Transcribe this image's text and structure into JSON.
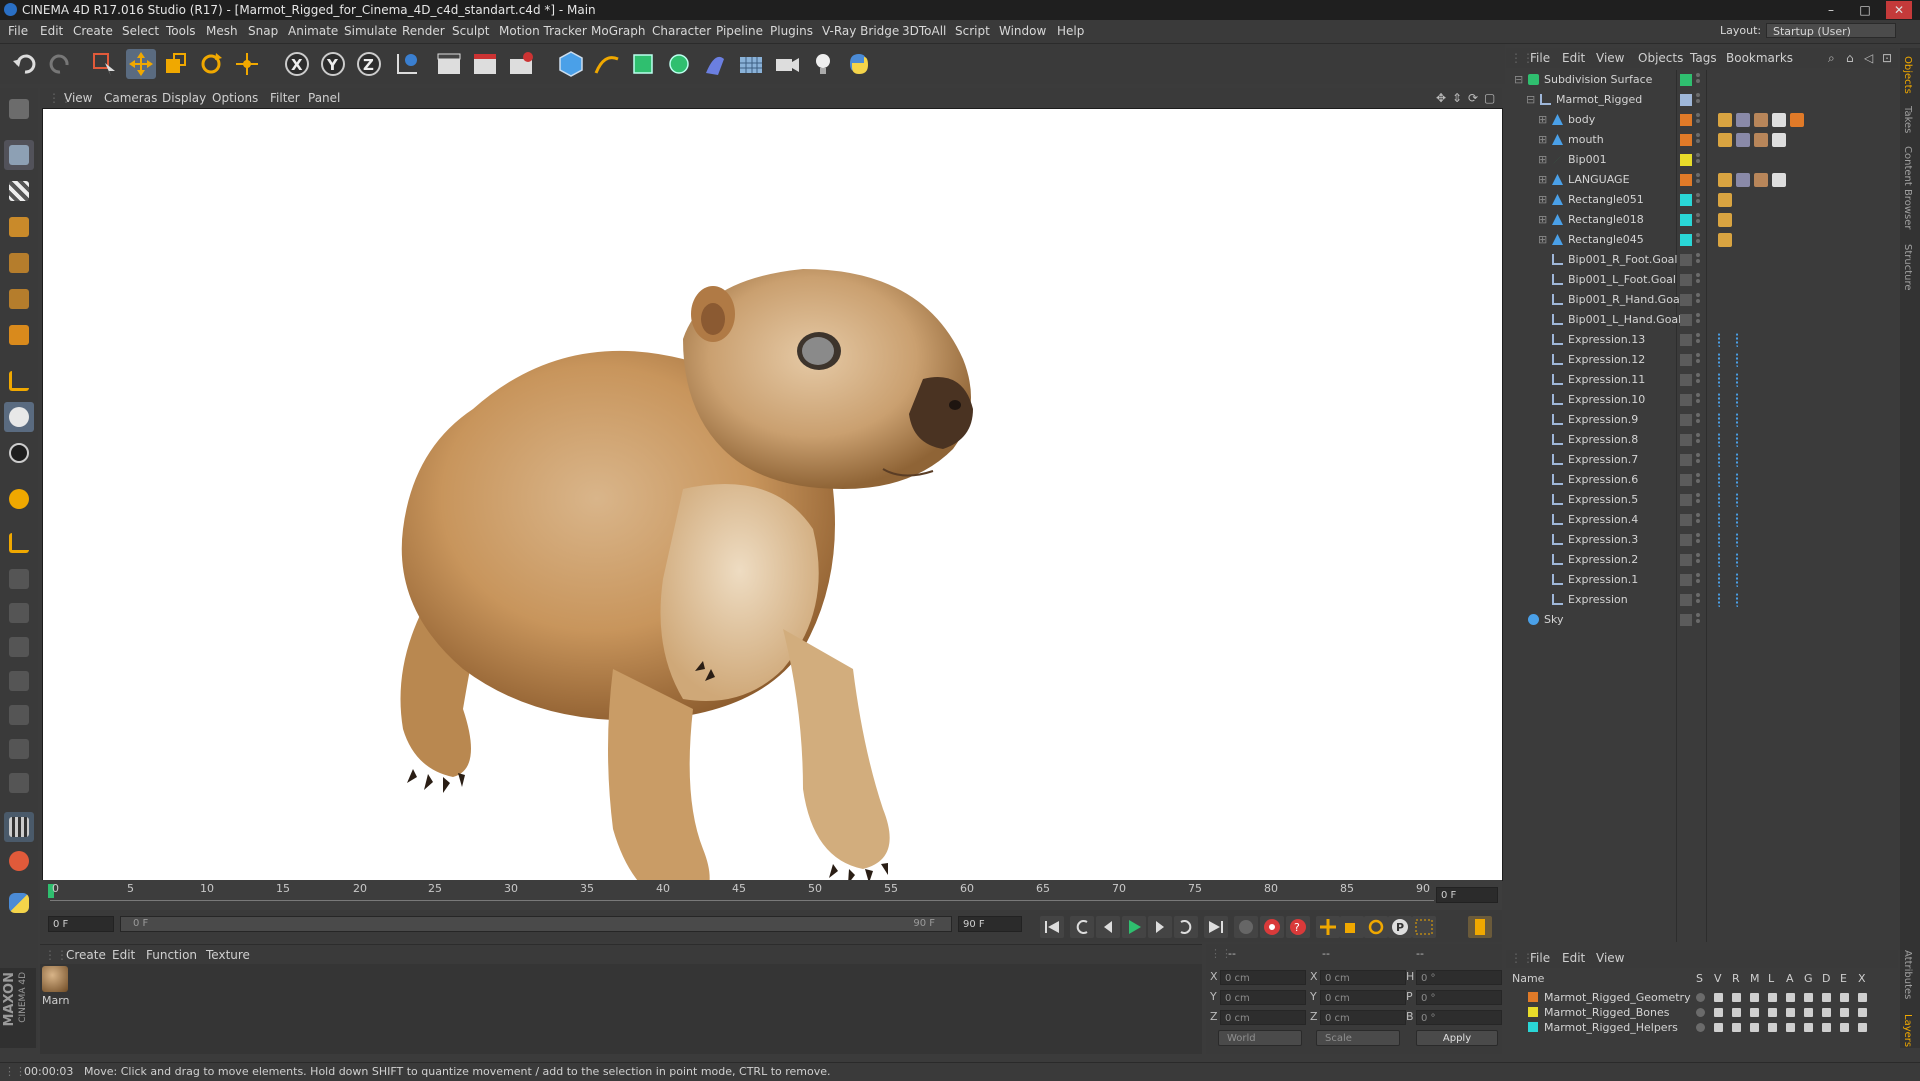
{
  "window": {
    "title": "CINEMA 4D R17.016 Studio (R17) - [Marmot_Rigged_for_Cinema_4D_c4d_standart.c4d *] - Main",
    "controls": [
      "–",
      "□",
      "✕"
    ]
  },
  "menu": [
    "File",
    "Edit",
    "Create",
    "Select",
    "Tools",
    "Mesh",
    "Snap",
    "Animate",
    "Simulate",
    "Render",
    "Sculpt",
    "Motion Tracker",
    "MoGraph",
    "Character",
    "Pipeline",
    "Plugins",
    "V-Ray Bridge",
    "3DToAll",
    "Script",
    "Window",
    "Help"
  ],
  "layout": {
    "label": "Layout:",
    "value": "Startup (User)"
  },
  "viewport_menu": [
    "View",
    "Cameras",
    "Display",
    "Options",
    "Filter",
    "Panel"
  ],
  "timeline": {
    "ticks": [
      "0",
      "5",
      "10",
      "15",
      "20",
      "25",
      "30",
      "35",
      "40",
      "45",
      "50",
      "55",
      "60",
      "65",
      "70",
      "75",
      "80",
      "85",
      "90"
    ],
    "current_frame_field": "0 F",
    "start_field": "0 F",
    "range_start": "0 F",
    "range_end": "90 F",
    "end_field": "90 F"
  },
  "material_menu": [
    "Create",
    "Edit",
    "Function",
    "Texture"
  ],
  "material": {
    "name": "Marn"
  },
  "brand": {
    "maxon": "MAXON",
    "c4d": "CINEMA 4D"
  },
  "coords": {
    "headers": [
      "--",
      "--",
      "--"
    ],
    "rows": [
      {
        "l1": "X",
        "v1": "0 cm",
        "l2": "X",
        "v2": "0 cm",
        "l3": "H",
        "v3": "0 °"
      },
      {
        "l1": "Y",
        "v1": "0 cm",
        "l2": "Y",
        "v2": "0 cm",
        "l3": "P",
        "v3": "0 °"
      },
      {
        "l1": "Z",
        "v1": "0 cm",
        "l2": "Z",
        "v2": "0 cm",
        "l3": "B",
        "v3": "0 °"
      }
    ],
    "world": "World",
    "scale": "Scale",
    "apply": "Apply"
  },
  "object_manager": {
    "menu": [
      "File",
      "Edit",
      "View",
      "Objects",
      "Tags",
      "Bookmarks"
    ],
    "objects": [
      {
        "name": "Subdivision Surface",
        "indent": 0,
        "icon": "subdivision-icon",
        "color": "#2fbf6f",
        "tags": 0
      },
      {
        "name": "Marmot_Rigged",
        "indent": 1,
        "icon": "null-icon",
        "color": "#9fb7d9",
        "tags": 0
      },
      {
        "name": "body",
        "indent": 2,
        "icon": "polygon-icon",
        "color": "#e07a28",
        "tags": 5
      },
      {
        "name": "mouth",
        "indent": 2,
        "icon": "polygon-icon",
        "color": "#e07a28",
        "tags": 4
      },
      {
        "name": "Bip001",
        "indent": 2,
        "icon": "bone-icon",
        "color": "#e8dc2a",
        "tags": 0
      },
      {
        "name": "LANGUAGE",
        "indent": 2,
        "icon": "polygon-icon",
        "color": "#e07a28",
        "tags": 4
      },
      {
        "name": "Rectangle051",
        "indent": 2,
        "icon": "polygon-icon",
        "color": "#2ad6d6",
        "tags": 1
      },
      {
        "name": "Rectangle018",
        "indent": 2,
        "icon": "polygon-icon",
        "color": "#2ad6d6",
        "tags": 1
      },
      {
        "name": "Rectangle045",
        "indent": 2,
        "icon": "polygon-icon",
        "color": "#2ad6d6",
        "tags": 1
      },
      {
        "name": "Bip001_R_Foot.Goal",
        "indent": 2,
        "icon": "null-icon",
        "color": "",
        "tags": 0
      },
      {
        "name": "Bip001_L_Foot.Goal",
        "indent": 2,
        "icon": "null-icon",
        "color": "",
        "tags": 0
      },
      {
        "name": "Bip001_R_Hand.Goal",
        "indent": 2,
        "icon": "null-icon",
        "color": "",
        "tags": 0
      },
      {
        "name": "Bip001_L_Hand.Goal",
        "indent": 2,
        "icon": "null-icon",
        "color": "",
        "tags": 0
      },
      {
        "name": "Expression.13",
        "indent": 2,
        "icon": "null-icon",
        "color": "",
        "tags": 2
      },
      {
        "name": "Expression.12",
        "indent": 2,
        "icon": "null-icon",
        "color": "",
        "tags": 2
      },
      {
        "name": "Expression.11",
        "indent": 2,
        "icon": "null-icon",
        "color": "",
        "tags": 2
      },
      {
        "name": "Expression.10",
        "indent": 2,
        "icon": "null-icon",
        "color": "",
        "tags": 2
      },
      {
        "name": "Expression.9",
        "indent": 2,
        "icon": "null-icon",
        "color": "",
        "tags": 2
      },
      {
        "name": "Expression.8",
        "indent": 2,
        "icon": "null-icon",
        "color": "",
        "tags": 2
      },
      {
        "name": "Expression.7",
        "indent": 2,
        "icon": "null-icon",
        "color": "",
        "tags": 2
      },
      {
        "name": "Expression.6",
        "indent": 2,
        "icon": "null-icon",
        "color": "",
        "tags": 2
      },
      {
        "name": "Expression.5",
        "indent": 2,
        "icon": "null-icon",
        "color": "",
        "tags": 2
      },
      {
        "name": "Expression.4",
        "indent": 2,
        "icon": "null-icon",
        "color": "",
        "tags": 2
      },
      {
        "name": "Expression.3",
        "indent": 2,
        "icon": "null-icon",
        "color": "",
        "tags": 2
      },
      {
        "name": "Expression.2",
        "indent": 2,
        "icon": "null-icon",
        "color": "",
        "tags": 2
      },
      {
        "name": "Expression.1",
        "indent": 2,
        "icon": "null-icon",
        "color": "",
        "tags": 2
      },
      {
        "name": "Expression",
        "indent": 2,
        "icon": "null-icon",
        "color": "",
        "tags": 2
      },
      {
        "name": "Sky",
        "indent": 0,
        "icon": "sky-icon",
        "color": "",
        "tags": 0
      }
    ]
  },
  "layer_manager": {
    "menu": [
      "File",
      "Edit",
      "View"
    ],
    "header_name": "Name",
    "columns": [
      "S",
      "V",
      "R",
      "M",
      "L",
      "A",
      "G",
      "D",
      "E",
      "X"
    ],
    "layers": [
      {
        "name": "Marmot_Rigged_Geometry",
        "color": "#e07a28"
      },
      {
        "name": "Marmot_Rigged_Bones",
        "color": "#e8dc2a"
      },
      {
        "name": "Marmot_Rigged_Helpers",
        "color": "#2ad6d6"
      }
    ]
  },
  "right_tabs": [
    "Objects",
    "Takes",
    "Content Browser",
    "Structure",
    "Attributes",
    "Layers"
  ],
  "status": {
    "time": "00:00:03",
    "message": "Move: Click and drag to move elements. Hold down SHIFT to quantize movement / add to the selection in point mode, CTRL to remove."
  }
}
